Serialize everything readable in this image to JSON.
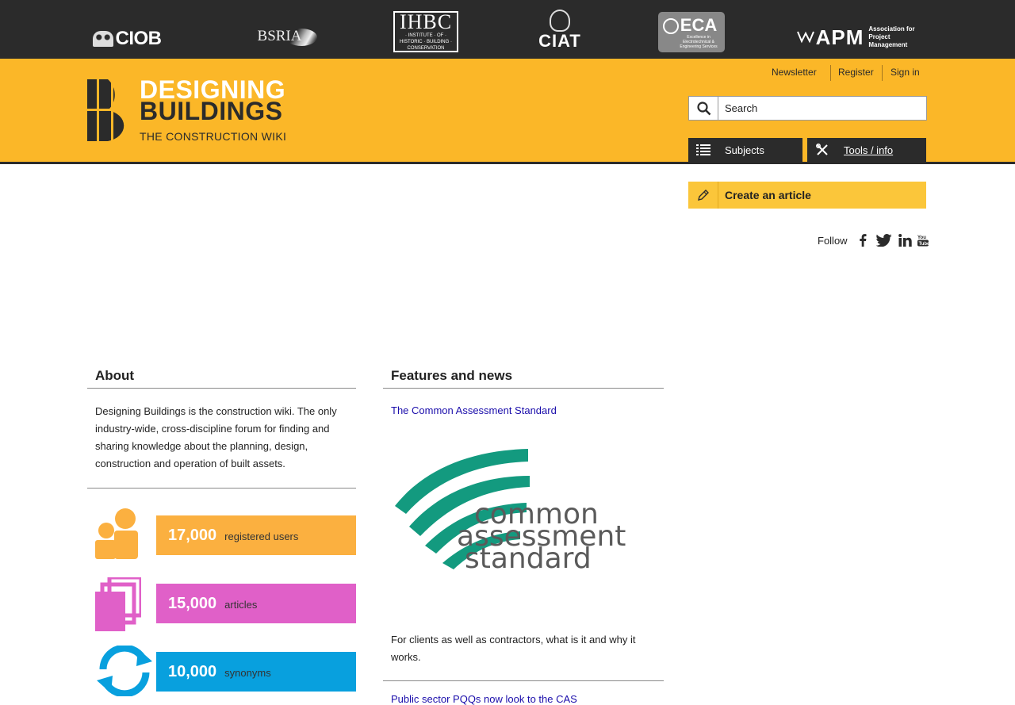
{
  "partners": {
    "ciob": "CIOB",
    "bsria": "BSRIA",
    "ihbc": "IHBC",
    "ihbc_sub": "· INSTITUTE · OF · HISTORIC · BUILDING · CONSERVATION",
    "ciat": "CIAT",
    "eca": "ECA",
    "eca_sub": "Excellence in Electrotechnical & Engineering Services",
    "apm": "APM",
    "apm_sub": "Association for Project Management"
  },
  "brand": {
    "line1": "DESIGNING",
    "line2": "BUILDINGS",
    "tagline": "THE CONSTRUCTION WIKI"
  },
  "toplinks": {
    "newsletter": "Newsletter",
    "register": "Register",
    "signin": "Sign in"
  },
  "search": {
    "placeholder": "Search"
  },
  "nav": {
    "subjects": "Subjects",
    "tools": "Tools / info",
    "create": "Create an article"
  },
  "follow": {
    "label": "Follow",
    "icons": [
      "facebook-icon",
      "twitter-icon",
      "linkedin-icon",
      "youtube-icon"
    ]
  },
  "about": {
    "heading": "About",
    "text": "Designing Buildings is the construction wiki. The only industry-wide, cross-discipline forum for finding and sharing knowledge about the planning, design, construction and operation of built assets."
  },
  "stats": [
    {
      "number": "17,000",
      "label": "registered users",
      "color": "#fbb040"
    },
    {
      "number": "15,000",
      "label": "articles",
      "color": "#e060c8"
    },
    {
      "number": "10,000",
      "label": "synonyms",
      "color": "#08a0de"
    }
  ],
  "features": {
    "heading": "Features and news",
    "article1_title": "The Common Assessment Standard",
    "logo_line1": "common",
    "logo_line2": "assessment",
    "logo_line3": "standard",
    "article1_desc": "For clients as well as contractors, what is it and why it works.",
    "article2_title": "Public sector PQQs now look to the CAS"
  },
  "colors": {
    "partner_bar": "#2b2b2b",
    "header_yellow": "#fbb728",
    "create_yellow": "#fbc63a",
    "link_blue": "#1a0dab",
    "cas_green": "#139a7f",
    "cas_grey": "#5a5a5a"
  }
}
